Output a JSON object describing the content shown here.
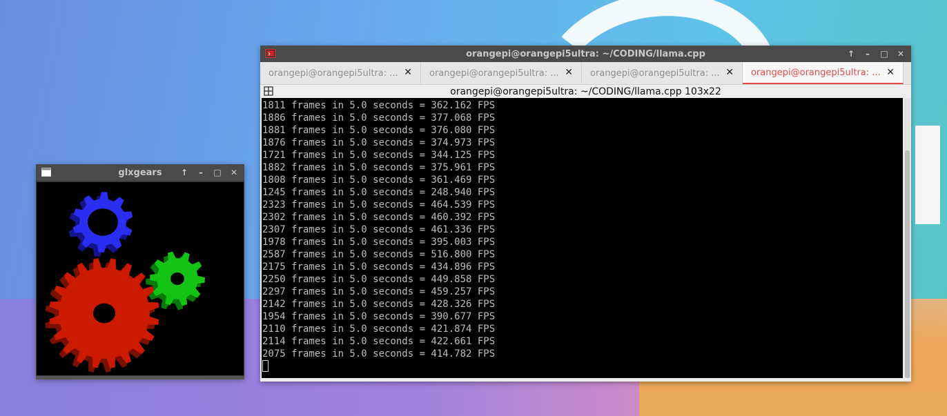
{
  "glxgears": {
    "title": "glxgears",
    "buttons": [
      "↑",
      "–",
      "□",
      "✕"
    ]
  },
  "terminal": {
    "title": "orangepi@orangepi5ultra: ~/CODING/llama.cpp",
    "buttons": [
      "↑",
      "–",
      "□",
      "✕"
    ],
    "tabs": [
      {
        "label": "orangepi@orangepi5ultra: ...",
        "close": "✕"
      },
      {
        "label": "orangepi@orangepi5ultra: ...",
        "close": "✕"
      },
      {
        "label": "orangepi@orangepi5ultra: ...",
        "close": "✕"
      },
      {
        "label": "orangepi@orangepi5ultra: ...",
        "close": "✕"
      }
    ],
    "subtitle": "orangepi@orangepi5ultra: ~/CODING/llama.cpp 103x22",
    "output_lines": [
      "1811 frames in 5.0 seconds = 362.162 FPS",
      "1886 frames in 5.0 seconds = 377.068 FPS",
      "1881 frames in 5.0 seconds = 376.080 FPS",
      "1876 frames in 5.0 seconds = 374.973 FPS",
      "1721 frames in 5.0 seconds = 344.125 FPS",
      "1882 frames in 5.0 seconds = 375.961 FPS",
      "1808 frames in 5.0 seconds = 361.469 FPS",
      "1245 frames in 5.0 seconds = 248.940 FPS",
      "2323 frames in 5.0 seconds = 464.539 FPS",
      "2302 frames in 5.0 seconds = 460.392 FPS",
      "2307 frames in 5.0 seconds = 461.336 FPS",
      "1978 frames in 5.0 seconds = 395.003 FPS",
      "2587 frames in 5.0 seconds = 516.800 FPS",
      "2175 frames in 5.0 seconds = 434.896 FPS",
      "2250 frames in 5.0 seconds = 449.858 FPS",
      "2297 frames in 5.0 seconds = 459.257 FPS",
      "2142 frames in 5.0 seconds = 428.326 FPS",
      "1954 frames in 5.0 seconds = 390.677 FPS",
      "2110 frames in 5.0 seconds = 421.874 FPS",
      "2114 frames in 5.0 seconds = 422.661 FPS",
      "2075 frames in 5.0 seconds = 414.782 FPS"
    ]
  },
  "colors": {
    "active_tab": "#e34b4b",
    "gear_red": "#cc1a00",
    "gear_green": "#14c414",
    "gear_blue": "#2a2ef0",
    "terminal_text": "#bdbdbd"
  },
  "icons": {
    "glx_app": "window-icon",
    "term_app": "terminal-icon",
    "menu": "tab-menu-icon"
  }
}
